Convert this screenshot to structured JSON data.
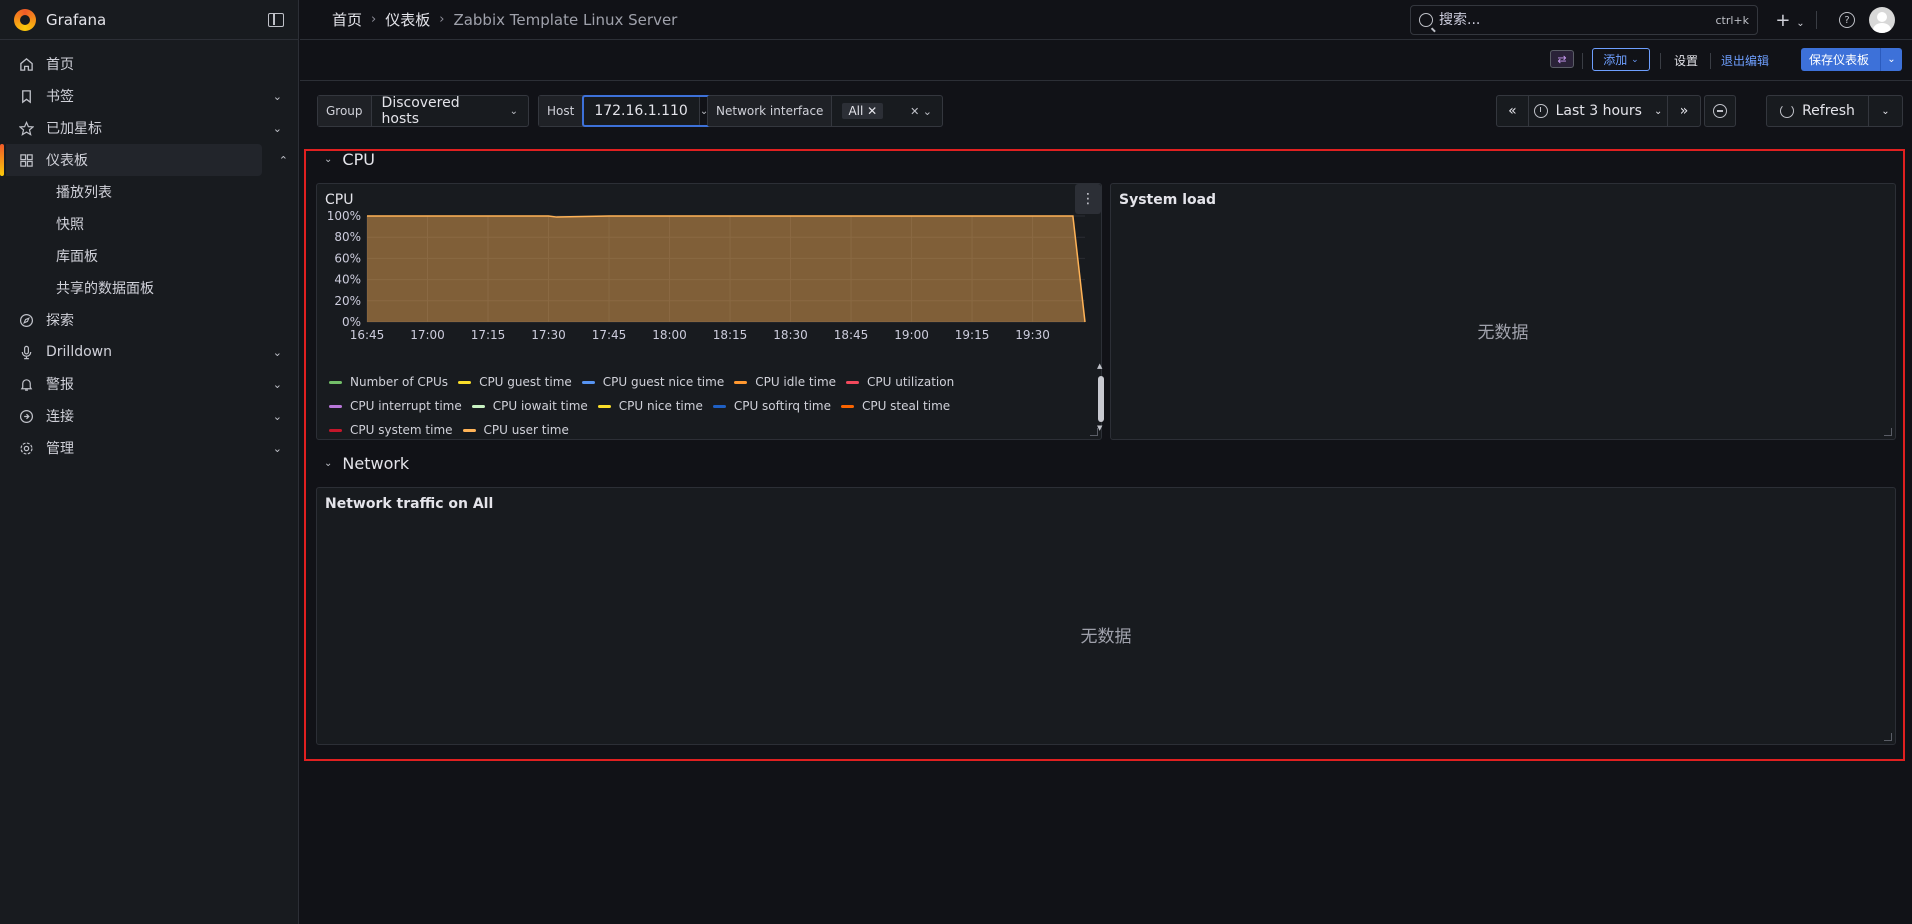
{
  "app": {
    "name": "Grafana"
  },
  "sidebar": {
    "items": [
      {
        "label": "首页",
        "icon": "home-icon"
      },
      {
        "label": "书签",
        "icon": "bookmark-icon"
      },
      {
        "label": "已加星标",
        "icon": "star-icon"
      },
      {
        "label": "仪表板",
        "icon": "dashboards-icon"
      },
      {
        "label": "探索",
        "icon": "compass-icon"
      },
      {
        "label": "Drilldown",
        "icon": "microphone-icon"
      },
      {
        "label": "警报",
        "icon": "bell-icon"
      },
      {
        "label": "连接",
        "icon": "link-icon"
      },
      {
        "label": "管理",
        "icon": "gear-icon"
      }
    ],
    "sub": [
      "播放列表",
      "快照",
      "库面板",
      "共享的数据面板"
    ]
  },
  "breadcrumb": {
    "home": "首页",
    "dashboards": "仪表板",
    "current": "Zabbix Template Linux Server"
  },
  "search": {
    "placeholder": "搜索...",
    "shortcut": "ctrl+k"
  },
  "actions": {
    "add": "添加",
    "settings": "设置",
    "exit_edit": "退出编辑",
    "save": "保存仪表板"
  },
  "variables": {
    "group": {
      "label": "Group",
      "value": "Discovered hosts"
    },
    "host": {
      "label": "Host",
      "value": "172.16.1.110"
    },
    "iface": {
      "label": "Network interface",
      "value": "All"
    }
  },
  "timepicker": {
    "range": "Last 3 hours",
    "refresh": "Refresh"
  },
  "rows": {
    "cpu": "CPU",
    "network": "Network"
  },
  "panels": {
    "cpu": {
      "title": "CPU"
    },
    "load": {
      "title": "System load",
      "nodata": "无数据"
    },
    "net": {
      "title": "Network traffic on All",
      "nodata": "无数据"
    }
  },
  "chart_data": {
    "type": "area",
    "title": "CPU",
    "x": [
      "16:45",
      "17:00",
      "17:15",
      "17:30",
      "17:45",
      "18:00",
      "18:15",
      "18:30",
      "18:45",
      "19:00",
      "19:15",
      "19:30"
    ],
    "x_range": [
      "16:45",
      "19:43"
    ],
    "y_ticks": [
      "0%",
      "20%",
      "40%",
      "60%",
      "80%",
      "100%"
    ],
    "ylim": [
      0,
      100
    ],
    "grid": true,
    "legend_position": "bottom",
    "series": [
      {
        "name": "Number of CPUs",
        "color": "#73bf69"
      },
      {
        "name": "CPU guest time",
        "color": "#fade2a"
      },
      {
        "name": "CPU guest nice time",
        "color": "#5794f2"
      },
      {
        "name": "CPU idle time",
        "color": "#ff9830"
      },
      {
        "name": "CPU utilization",
        "color": "#f2495c"
      },
      {
        "name": "CPU interrupt time",
        "color": "#b877d9"
      },
      {
        "name": "CPU iowait time",
        "color": "#c8f2c2"
      },
      {
        "name": "CPU nice time",
        "color": "#fade2a"
      },
      {
        "name": "CPU softirq time",
        "color": "#1f60c4"
      },
      {
        "name": "CPU steal time",
        "color": "#fa6400"
      },
      {
        "name": "CPU system time",
        "color": "#c4162a"
      },
      {
        "name": "CPU user time",
        "color": "#ffb357"
      }
    ],
    "user_time_series": {
      "x": [
        "16:45",
        "17:30",
        "17:32",
        "17:45",
        "19:40",
        "19:43"
      ],
      "values": [
        100,
        100,
        99,
        100,
        100,
        0
      ]
    }
  }
}
